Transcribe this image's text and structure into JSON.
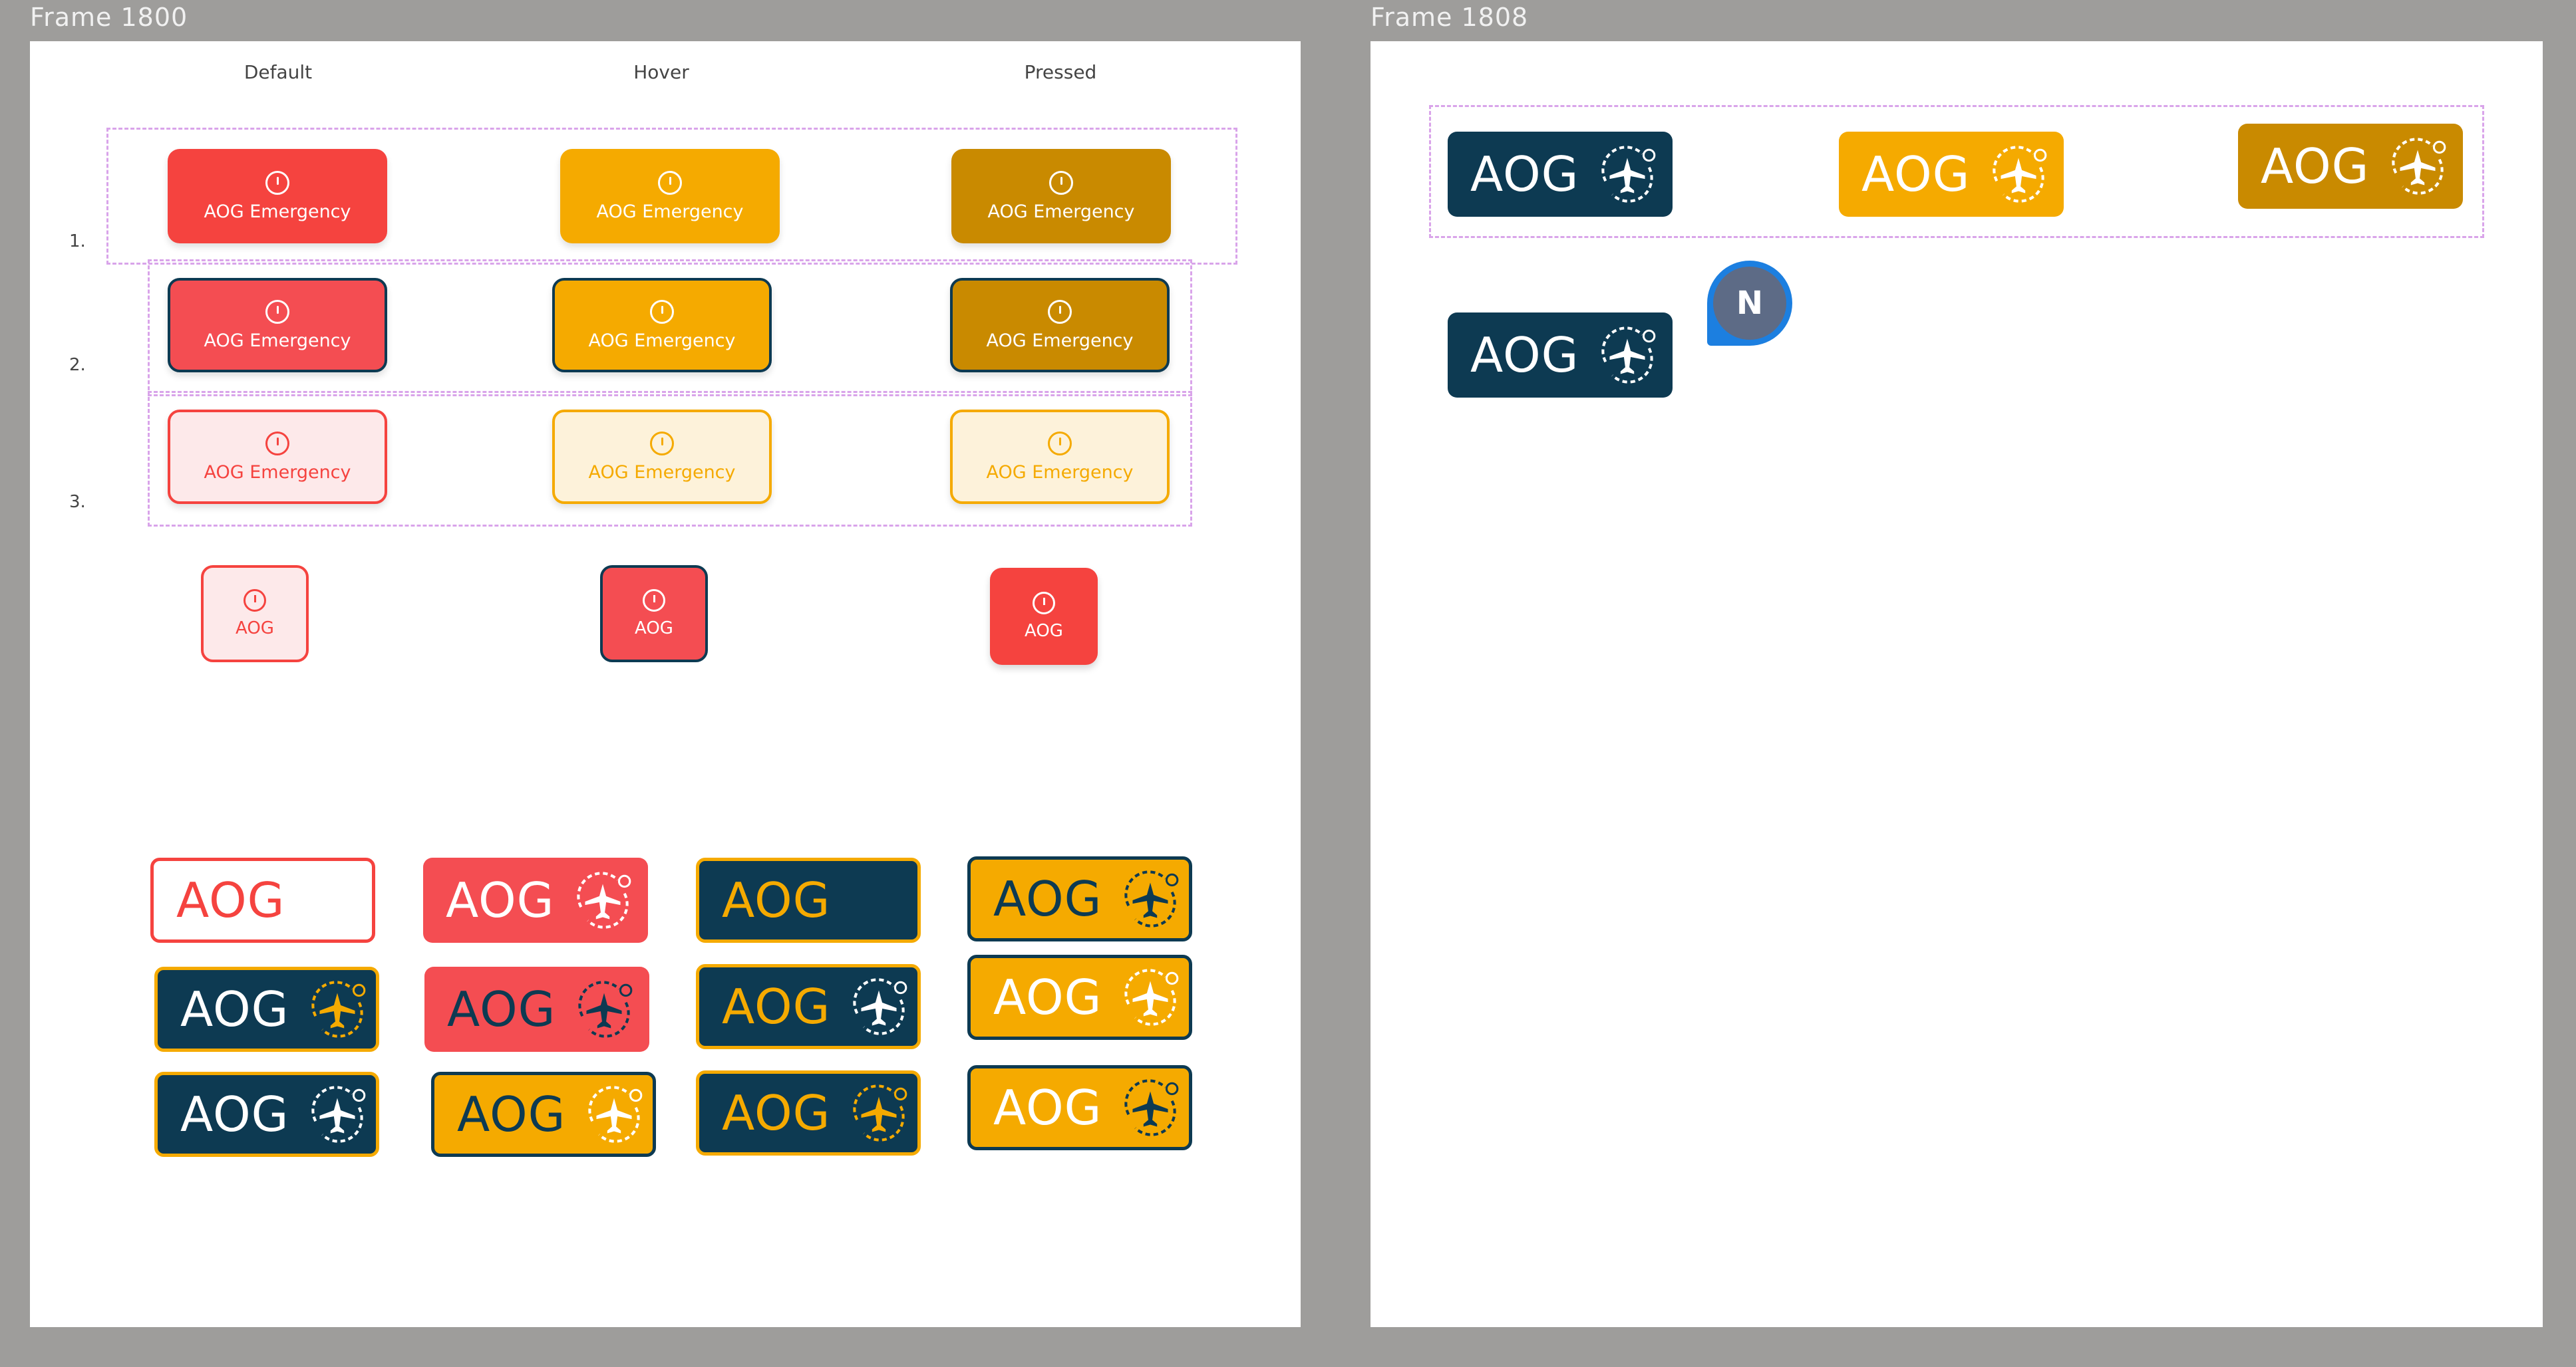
{
  "frames": [
    {
      "label": "Frame 1800"
    },
    {
      "label": "Frame 1808"
    }
  ],
  "columns": [
    "Default",
    "Hover",
    "Pressed"
  ],
  "rows": [
    "1.",
    "2.",
    "3."
  ],
  "emergency_label": "AOG Emergency",
  "short_label": "AOG",
  "badge_text": "AOG",
  "avatar_initial": "N",
  "colors": {
    "red": "#f5433f",
    "red_soft": "#f44d52",
    "amber": "#f5aa00",
    "amber_dark": "#c98a00",
    "navy": "#0d3a52",
    "red_tint": "#fde9ea",
    "amber_tint": "#fdf2da",
    "avatar_blue": "#1c7fe0"
  },
  "icons": [
    "alert-icon",
    "airplane-cycle-icon"
  ]
}
